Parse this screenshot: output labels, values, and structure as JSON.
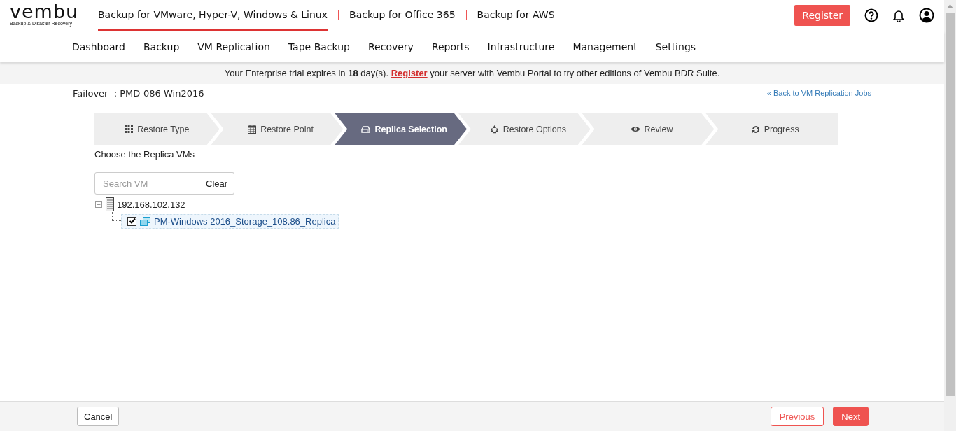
{
  "header": {
    "logo": {
      "word": "vembu",
      "tagline": "Backup & Disaster Recovery"
    },
    "products": [
      {
        "label": "Backup for VMware, Hyper-V, Windows & Linux",
        "selected": true
      },
      {
        "label": "Backup for Office 365",
        "selected": false
      },
      {
        "label": "Backup for AWS",
        "selected": false
      }
    ],
    "register_button": "Register"
  },
  "nav": [
    "Dashboard",
    "Backup",
    "VM Replication",
    "Tape Backup",
    "Recovery",
    "Reports",
    "Infrastructure",
    "Management",
    "Settings"
  ],
  "banner": {
    "text_before": "Your Enterprise trial expires in **18** day(s).",
    "link": "Register",
    "text_after": "your server with Vembu Portal to try other editions of Vembu BDR Suite."
  },
  "page": {
    "title": "Failover  : PMD-086-Win2016",
    "back_link": "« Back to VM Replication Jobs"
  },
  "steps": [
    {
      "label": "Restore Type",
      "selected": false
    },
    {
      "label": "Restore Point",
      "selected": false
    },
    {
      "label": "Replica Selection",
      "selected": true
    },
    {
      "label": "Restore Options",
      "selected": false
    },
    {
      "label": "Review",
      "selected": false
    },
    {
      "label": "Progress",
      "selected": false
    }
  ],
  "section_title": "Choose the Replica VMs",
  "search": {
    "placeholder": "Search VM",
    "clear_button": "Clear"
  },
  "tree": [
    {
      "label": "192.168.102.132",
      "expanded": true,
      "children": [
        {
          "label": "PM-Windows 2016_Storage_108.86_Replica",
          "checked": true,
          "selected": true
        }
      ]
    }
  ],
  "footer": {
    "cancel": "Cancel",
    "previous": "Previous",
    "next": "Next"
  }
}
